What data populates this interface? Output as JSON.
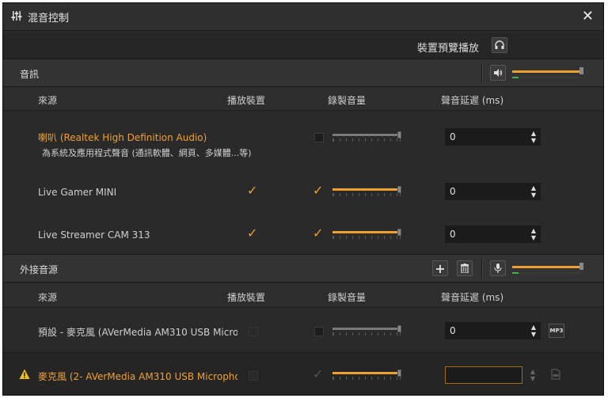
{
  "window": {
    "title": "混音控制"
  },
  "preview": {
    "label": "裝置預覽播放"
  },
  "audio_section": {
    "title": "音訊",
    "columns": {
      "source": "來源",
      "playback": "播放裝置",
      "record": "錄製音量",
      "delay": "聲音延遲 (ms)"
    },
    "rows": [
      {
        "name": "喇叭 (Realtek High Definition Audio)",
        "subtitle": "為系統及應用程式聲音 (通訊軟體、網頁、多媒體...等)",
        "playback_checked": false,
        "record_checked": false,
        "record_level": 1.0,
        "delay": "0"
      },
      {
        "name": "Live Gamer MINI",
        "playback_checked": true,
        "record_checked": true,
        "record_level": 1.0,
        "delay": "0"
      },
      {
        "name": "Live Streamer CAM 313",
        "playback_checked": true,
        "record_checked": true,
        "record_level": 1.0,
        "delay": "0"
      }
    ],
    "master_level": 1.0
  },
  "external_section": {
    "title": "外接音源",
    "columns": {
      "source": "來源",
      "playback": "播放裝置",
      "record": "錄製音量",
      "delay": "聲音延遲 (ms)"
    },
    "rows": [
      {
        "name": "預設 - 麥克風 (AVerMedia AM310 USB Microp",
        "record_level": 1.0,
        "delay": "0",
        "extra_button": "MP3"
      },
      {
        "name": "麥克風 (2- AVerMedia AM310 USB Micropho",
        "record_level": 1.0,
        "delay": "",
        "warning": true
      }
    ],
    "master_level": 1.0
  },
  "colors": {
    "accent": "#f0a030",
    "background": "#2a2a2a"
  }
}
